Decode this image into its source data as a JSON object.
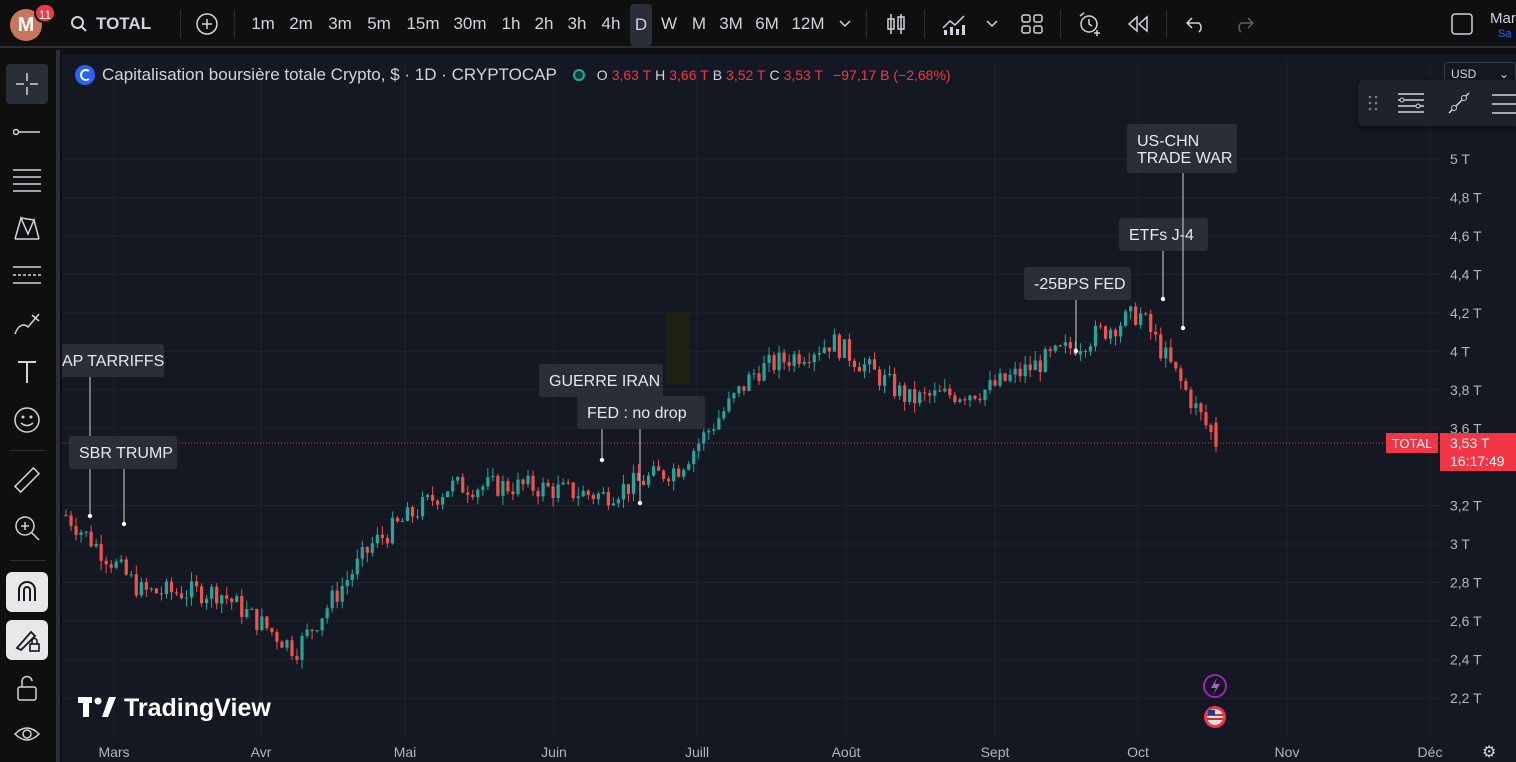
{
  "topbar": {
    "avatar_letter": "M",
    "notifications": "11",
    "symbol": "TOTAL",
    "timeframes": [
      "1m",
      "2m",
      "3m",
      "5m",
      "15m",
      "30m",
      "1h",
      "2h",
      "3h",
      "4h",
      "D",
      "W",
      "M",
      "3M",
      "6M",
      "12M"
    ],
    "active_timeframe": "D",
    "user_label": "Mar",
    "user_sub": "Sa"
  },
  "legend": {
    "title": "Capitalisation boursière totale Crypto, $ · 1D · CRYPTOCAP",
    "o_key": "O",
    "o_val": "3,63 T",
    "h_key": "H",
    "h_val": "3,66 T",
    "b_key": "B",
    "b_val": "3,52 T",
    "c_key": "C",
    "c_val": "3,53 T",
    "change": "−97,17 B (−2,68%)"
  },
  "currency": "USD",
  "price_scale": {
    "ticks": [
      "5 T",
      "4,8 T",
      "4,6 T",
      "4,4 T",
      "4,2 T",
      "4 T",
      "3,8 T",
      "3,6 T",
      "3,2 T",
      "3 T",
      "2,8 T",
      "2,6 T",
      "2,4 T",
      "2,2 T"
    ],
    "current_label": "TOTAL",
    "current_price": "3,53 T",
    "countdown": "16:17:49"
  },
  "time_axis": [
    "Mars",
    "Avr",
    "Mai",
    "Juin",
    "Juill",
    "Août",
    "Sept",
    "Oct",
    "Nov",
    "Déc"
  ],
  "annotations": [
    {
      "text": "AP TARRIFFS"
    },
    {
      "text": "SBR TRUMP"
    },
    {
      "text": "GUERRE IRAN"
    },
    {
      "text": "FED : no drop"
    },
    {
      "text": "-25BPS FED"
    },
    {
      "text": "ETFs J-4"
    },
    {
      "text": "US-CHN"
    },
    {
      "text": "TRADE WAR"
    }
  ],
  "watermark": "TradingView",
  "chart_data": {
    "type": "candlestick",
    "series_name": "TOTAL",
    "colors": {
      "up": "#26a69a",
      "down": "#ef5350",
      "background": "#141823",
      "grid": "#1e2230"
    },
    "ylim": [
      2.1,
      5.1
    ],
    "x_labels": [
      "Mars",
      "Avr",
      "Mai",
      "Juin",
      "Juill",
      "Août",
      "Sept",
      "Oct",
      "Nov",
      "Déc"
    ],
    "monthly_path": [
      {
        "month": "Mars",
        "value": 3.15
      },
      {
        "month": "Mars",
        "value": 2.75
      },
      {
        "month": "Avr",
        "value": 2.75
      },
      {
        "month": "Avr",
        "value": 2.45
      },
      {
        "month": "Mai",
        "value": 3.0
      },
      {
        "month": "Mai",
        "value": 3.3
      },
      {
        "month": "Juin",
        "value": 3.3
      },
      {
        "month": "Juin",
        "value": 3.25
      },
      {
        "month": "Juill",
        "value": 3.4
      },
      {
        "month": "Juill",
        "value": 3.9
      },
      {
        "month": "Août",
        "value": 4.05
      },
      {
        "month": "Août",
        "value": 3.75
      },
      {
        "month": "Sept",
        "value": 3.8
      },
      {
        "month": "Sept",
        "value": 4.0
      },
      {
        "month": "Oct",
        "value": 4.2
      },
      {
        "month": "Oct",
        "value": 3.53
      }
    ],
    "last": {
      "open": 3.63,
      "high": 3.66,
      "low": 3.52,
      "close": 3.53
    }
  }
}
